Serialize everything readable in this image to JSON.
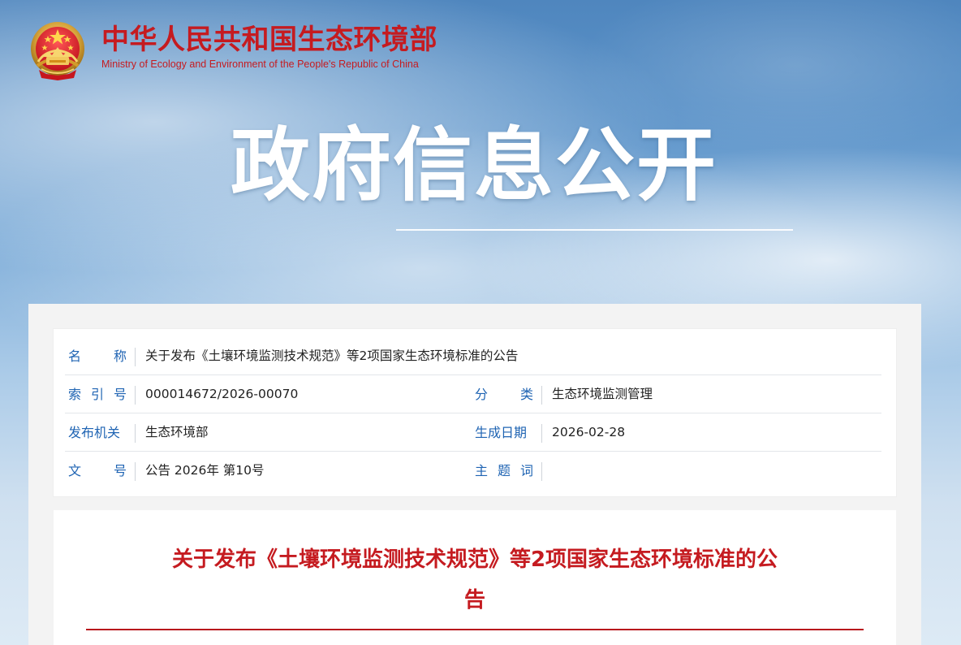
{
  "header": {
    "org_name_cn": "中华人民共和国生态环境部",
    "org_name_en": "Ministry of Ecology and Environment of the People's Republic of China",
    "emblem_icon": "national-emblem-icon"
  },
  "banner": {
    "title": "政府信息公开"
  },
  "metadata": {
    "name_label_parts": [
      "名",
      "称"
    ],
    "name_value": "关于发布《土壤环境监测技术规范》等2项国家生态环境标准的公告",
    "index_label_parts": [
      "索",
      "引",
      "号"
    ],
    "index_value": "000014672/2026-00070",
    "category_label_parts": [
      "分",
      "类"
    ],
    "category_value": "生态环境监测管理",
    "issuer_label": "发布机关",
    "issuer_value": "生态环境部",
    "date_label": "生成日期",
    "date_value": "2026-02-28",
    "doc_no_label_parts": [
      "文",
      "号"
    ],
    "doc_no_value": "公告 2026年 第10号",
    "subject_label_parts": [
      "主",
      "题",
      "词"
    ],
    "subject_value": ""
  },
  "article": {
    "title_line_1": "关于发布《土壤环境监测技术规范》等2项国家生态环境标准的公",
    "title_line_2": "告"
  },
  "colors": {
    "brand_red": "#c51b20",
    "label_blue": "#1f64b3",
    "text_dark": "#222222",
    "divider_red": "#b8161c"
  }
}
